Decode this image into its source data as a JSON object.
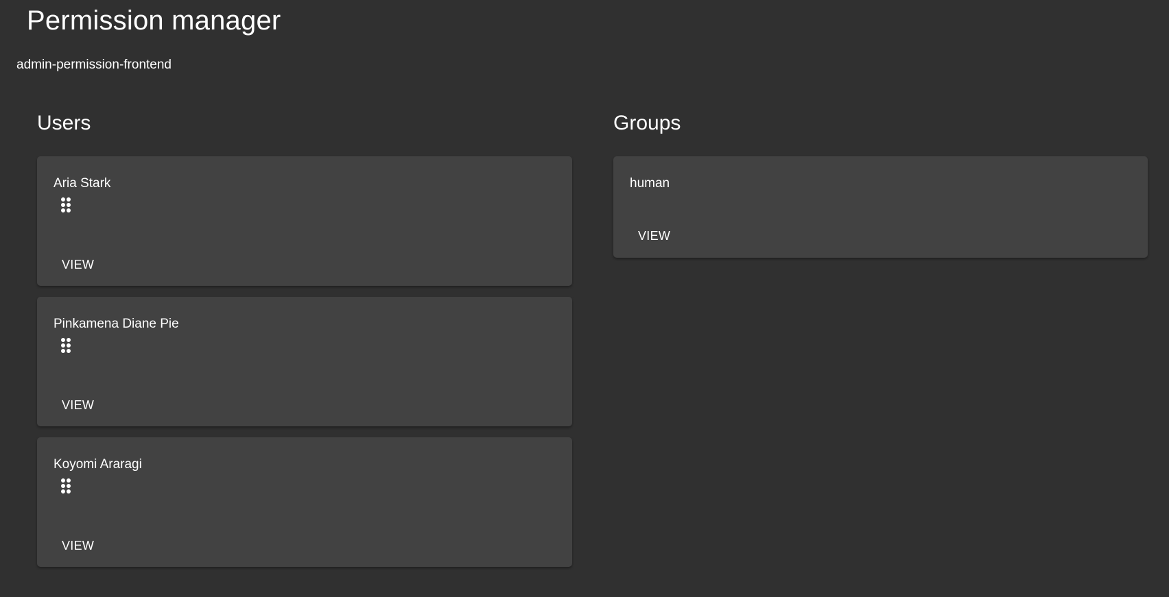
{
  "header": {
    "title": "Permission manager",
    "subtitle": "admin-permission-frontend"
  },
  "users": {
    "heading": "Users",
    "items": [
      {
        "name": "Aria Stark",
        "icon": "drag-handle-icon",
        "view_label": "VIEW"
      },
      {
        "name": "Pinkamena Diane Pie",
        "icon": "drag-handle-icon",
        "view_label": "VIEW"
      },
      {
        "name": "Koyomi Araragi",
        "icon": "drag-handle-icon",
        "view_label": "VIEW"
      }
    ]
  },
  "groups": {
    "heading": "Groups",
    "items": [
      {
        "name": "human",
        "view_label": "VIEW"
      }
    ]
  },
  "colors": {
    "background": "#303030",
    "card": "#424242",
    "text": "#ffffff"
  }
}
